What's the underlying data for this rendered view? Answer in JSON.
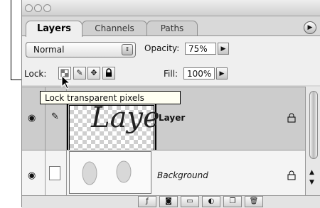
{
  "tabs": [
    {
      "label": "Layers"
    },
    {
      "label": "Channels"
    },
    {
      "label": "Paths"
    }
  ],
  "blend": {
    "mode": "Normal",
    "opacity_label": "Opacity:",
    "opacity_value": "75%"
  },
  "lock": {
    "label": "Lock:",
    "fill_label": "Fill:",
    "fill_value": "100%"
  },
  "tooltip": {
    "text": "Lock transparent pixels"
  },
  "layers": [
    {
      "name": "Layer",
      "thumb_text": "Laye"
    },
    {
      "name": "Background"
    }
  ],
  "icons": {
    "menu": "triangle-right-icon",
    "eye": "eye-icon",
    "brush": "brush-icon",
    "move": "move-icon",
    "lock": "lock-icon"
  }
}
